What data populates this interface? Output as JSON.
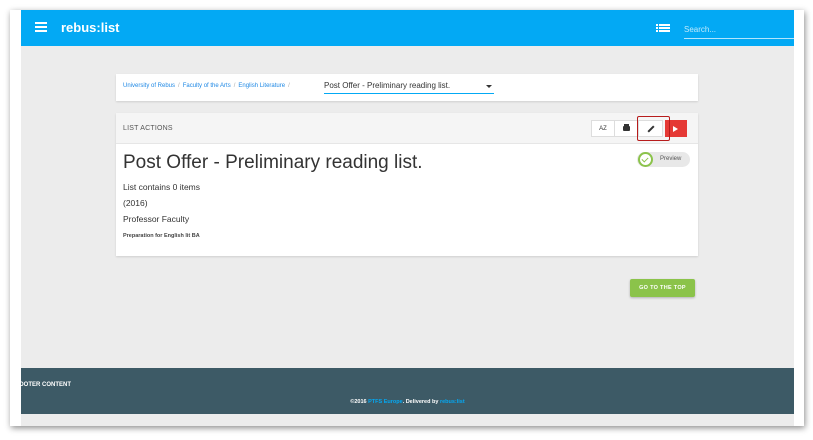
{
  "header": {
    "brand": "rebus:list",
    "search_placeholder": "Search..."
  },
  "breadcrumb": {
    "items": [
      "University of Rebus",
      "Faculty of the Arts",
      "English Literature"
    ],
    "separator": "/",
    "current_select": "Post Offer - Preliminary reading list."
  },
  "actions": {
    "label": "LIST ACTIONS",
    "az_label": "AZ",
    "preview_label": "Preview"
  },
  "list": {
    "title": "Post Offer - Preliminary reading list.",
    "item_count_text": "List contains 0 items",
    "year": "(2016)",
    "owner": "Professor Faculty",
    "description": "Preparation for English lit BA"
  },
  "go_top_label": "GO TO THE TOP",
  "footer": {
    "heading": "OOTER CONTENT",
    "copyright_prefix": "©2016 ",
    "copyright_org": "PTFS Europe",
    "copyright_mid": ". Delivered by ",
    "copyright_link": "rebus:list"
  },
  "colors": {
    "topbar": "#03a9f4",
    "footer": "#3d5a66",
    "go_top": "#8bc34a",
    "play": "#e53935",
    "highlight": "#b71c1c"
  },
  "icons": [
    "menu-icon",
    "list-view-icon",
    "sort-az-icon",
    "print-icon",
    "edit-icon",
    "play-icon",
    "check-icon"
  ]
}
